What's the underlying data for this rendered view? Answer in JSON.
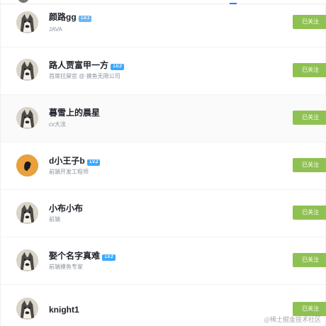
{
  "colors": {
    "follow_button": "#8fc152",
    "level_badge": "#3aa9ff",
    "level_badge_low": "#6ab5f4",
    "name": "#1d2129",
    "desc": "#8a919f",
    "tab_indicator": "#1e80ff"
  },
  "users": [
    {
      "name": "颜路gg",
      "level": "LV.1",
      "desc": "JAVA",
      "avatar": "husky-dog-icon",
      "follow_label": "已关注"
    },
    {
      "name": "路人贾富甲一方",
      "level": "LV.2",
      "desc": "首席拉屎官 @ 摸鱼无限公司",
      "avatar": "husky-dog-icon",
      "follow_label": "已关注"
    },
    {
      "name": "暮雪上的晨星",
      "level": "",
      "desc": "cv大法",
      "avatar": "husky-dog-icon",
      "follow_label": "已关注"
    },
    {
      "name": "d小王子b",
      "level": "LV.2",
      "desc": "前端开发工程师",
      "avatar": "orange-silhouette-icon",
      "follow_label": "已关注"
    },
    {
      "name": "小布小布",
      "level": "",
      "desc": "前端",
      "avatar": "husky-dog-icon",
      "follow_label": "已关注"
    },
    {
      "name": "娶个名字真难",
      "level": "LV.2",
      "desc": "前端摸鱼专家",
      "avatar": "husky-dog-icon",
      "follow_label": "已关注"
    },
    {
      "name": "knight1",
      "level": "",
      "desc": "",
      "avatar": "husky-dog-icon",
      "follow_label": "已关注"
    }
  ],
  "watermark": "@稀土掘金技术社区"
}
